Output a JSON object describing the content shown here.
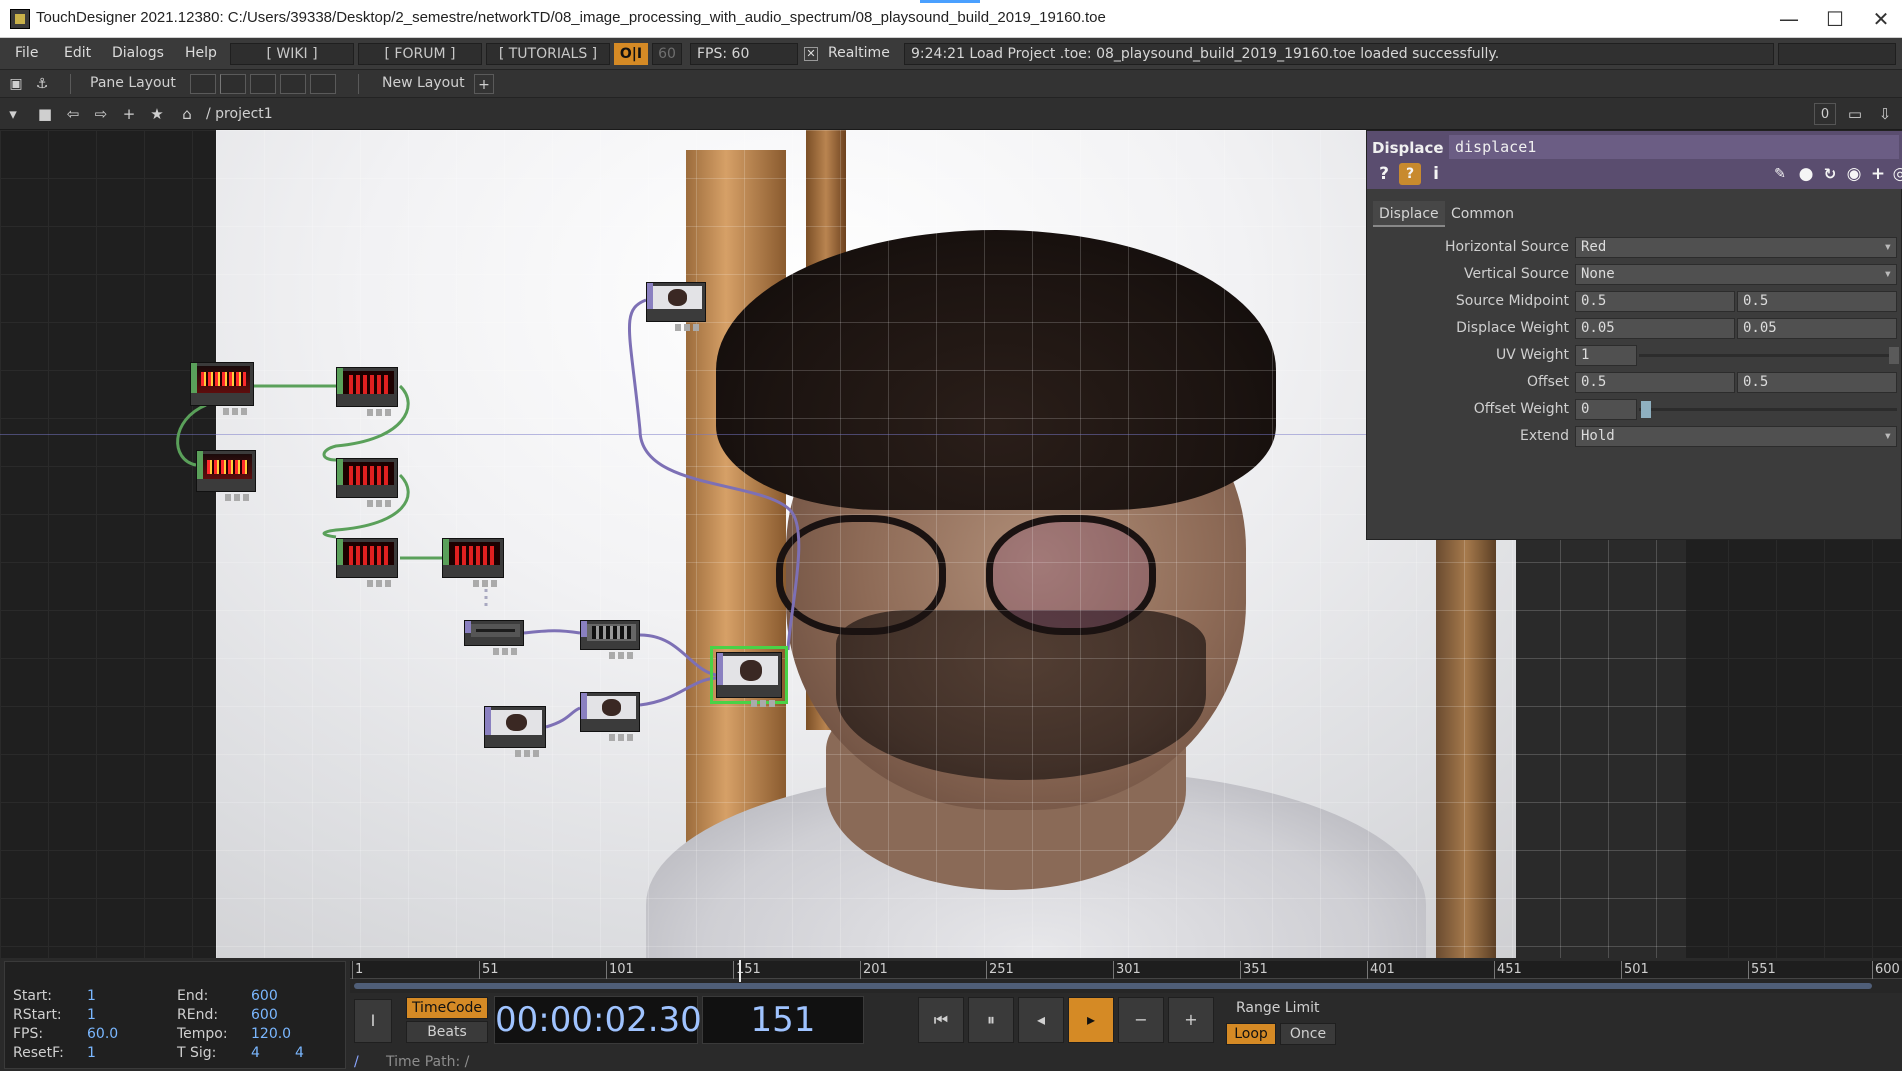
{
  "window": {
    "title": "TouchDesigner 2021.12380: C:/Users/39338/Desktop/2_semestre/networkTD/08_image_processing_with_audio_spectrum/08_playsound_build_2019_19160.toe",
    "minimize": "—",
    "maximize": "☐",
    "close": "✕"
  },
  "menubar": {
    "file": "File",
    "edit": "Edit",
    "dialogs": "Dialogs",
    "help": "Help",
    "wiki": "[ WIKI ]",
    "forum": "[ FORUM ]",
    "tutorials": "[ TUTORIALS ]",
    "oi": "O|I",
    "fps_limit": "60",
    "fps": "FPS:  60",
    "realtime_check": "✕",
    "realtime": "Realtime",
    "status": "9:24:21 Load Project .toe: 08_playsound_build_2019_19160.toe loaded successfully."
  },
  "panebar": {
    "pane_layout": "Pane Layout",
    "new_layout": "New Layout",
    "add": "+"
  },
  "pathbar": {
    "path": "/ project1",
    "counter": "0"
  },
  "params": {
    "op_type": "Displace",
    "op_name": "displace1",
    "tabs": [
      "Displace",
      "Common"
    ],
    "rows": {
      "horizontal_source": {
        "label": "Horizontal Source",
        "value": "Red"
      },
      "vertical_source": {
        "label": "Vertical Source",
        "value": "None"
      },
      "source_midpoint": {
        "label": "Source Midpoint",
        "v1": "0.5",
        "v2": "0.5"
      },
      "displace_weight": {
        "label": "Displace Weight",
        "v1": "0.05",
        "v2": "0.05"
      },
      "uv_weight": {
        "label": "UV Weight",
        "v1": "1"
      },
      "offset": {
        "label": "Offset",
        "v1": "0.5",
        "v2": "0.5"
      },
      "offset_weight": {
        "label": "Offset Weight",
        "v1": "0"
      },
      "extend": {
        "label": "Extend",
        "value": "Hold"
      }
    }
  },
  "timeline": {
    "start_label": "Start:",
    "start": "1",
    "end_label": "End:",
    "end": "600",
    "rstart_label": "RStart:",
    "rstart": "1",
    "rend_label": "REnd:",
    "rend": "600",
    "fps_label": "FPS:",
    "fps": "60.0",
    "tempo_label": "Tempo:",
    "tempo": "120.0",
    "resetf_label": "ResetF:",
    "resetf": "1",
    "tsig_label": "T Sig:",
    "tsig_a": "4",
    "tsig_b": "4",
    "ticks": [
      "1",
      "51",
      "101",
      "151",
      "201",
      "251",
      "301",
      "351",
      "401",
      "451",
      "501",
      "551",
      "600"
    ],
    "timecode_btn": "TimeCode",
    "beats_btn": "Beats",
    "timecode": "00:00:02.30",
    "frame": "151",
    "range_limit": "Range Limit",
    "loop": "Loop",
    "once": "Once",
    "time_path": "Time Path: /",
    "time_path_root": "/"
  }
}
